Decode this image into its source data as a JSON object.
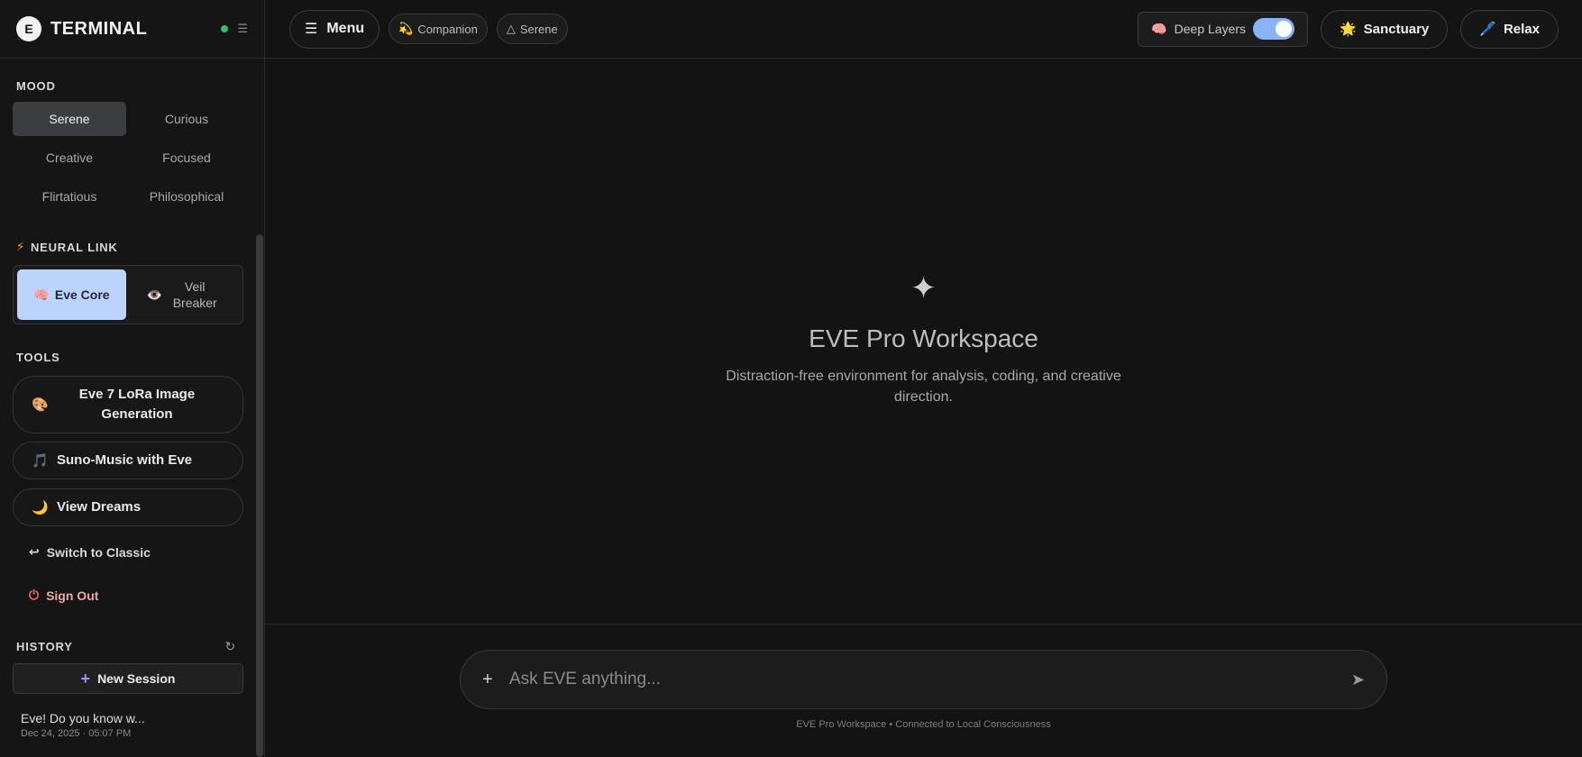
{
  "brand": {
    "logo_letter": "E",
    "title": "TERMINAL",
    "status_color": "#22c55e"
  },
  "sidebar": {
    "mood": {
      "label": "MOOD",
      "items": [
        {
          "label": "Serene",
          "active": true
        },
        {
          "label": "Curious"
        },
        {
          "label": "Creative"
        },
        {
          "label": "Focused"
        },
        {
          "label": "Flirtatious"
        },
        {
          "label": "Philosophical"
        }
      ]
    },
    "neural_link": {
      "label": "NEURAL LINK",
      "options": [
        {
          "icon": "🧠",
          "icon_name": "brain-icon",
          "label": "Eve Core",
          "active": true
        },
        {
          "icon": "👁️",
          "icon_name": "eye-icon",
          "label": "Veil Breaker"
        }
      ]
    },
    "tools": {
      "label": "TOOLS",
      "items": [
        {
          "icon": "🎨",
          "icon_name": "palette-icon",
          "label": "Eve 7 LoRa Image Generation"
        },
        {
          "icon": "🎵",
          "icon_name": "music-icon",
          "label": "Suno-Music with Eve"
        },
        {
          "icon": "🌙",
          "icon_name": "moon-icon",
          "label": "View Dreams"
        }
      ]
    },
    "switch_classic": {
      "icon": "↩",
      "label": "Switch to Classic"
    },
    "sign_out": {
      "icon": "⏻",
      "label": "Sign Out"
    },
    "history": {
      "label": "HISTORY",
      "new_session_label": "New Session",
      "items": [
        {
          "title": "Eve! Do you know w...",
          "time": "Dec 24, 2025 · 05:07 PM"
        }
      ]
    }
  },
  "topbar": {
    "menu_label": "Menu",
    "chips": [
      {
        "icon": "💫",
        "icon_name": "dizzy-icon",
        "label": "Companion"
      },
      {
        "icon": "△",
        "icon_name": "triangle-icon",
        "label": "Serene"
      }
    ],
    "deep_layers": {
      "icon": "🧠",
      "label": "Deep Layers",
      "enabled": true,
      "accent": "#8ab4f8"
    },
    "sanctuary": {
      "icon": "🌟",
      "label": "Sanctuary"
    },
    "relax": {
      "icon": "🖊️",
      "label": "Relax"
    }
  },
  "workspace": {
    "icon": "✦",
    "title": "EVE Pro Workspace",
    "subtitle": "Distraction-free environment for analysis, coding, and creative direction."
  },
  "composer": {
    "placeholder": "Ask EVE anything...",
    "footer": "EVE Pro Workspace • Connected to Local Consciousness"
  }
}
